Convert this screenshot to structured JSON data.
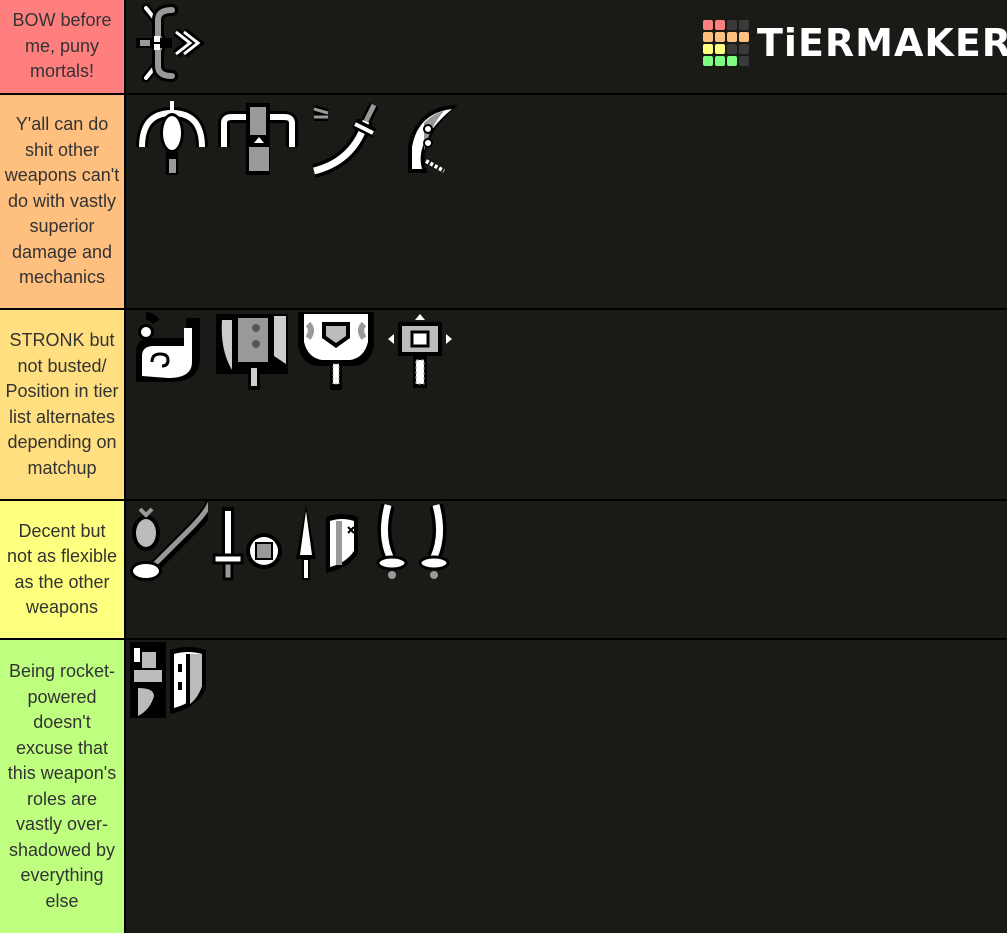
{
  "brand": {
    "name": "TiERMAKER",
    "grid_colors": [
      "#ff7f7f",
      "#ff7f7f",
      "#3a3a3a",
      "#3a3a3a",
      "#ffbf7f",
      "#ffbf7f",
      "#ffbf7f",
      "#ffbf7f",
      "#ffff7f",
      "#ffff7f",
      "#3a3a3a",
      "#3a3a3a",
      "#7fff7f",
      "#7fff7f",
      "#7fff7f",
      "#3a3a3a"
    ]
  },
  "tiers": [
    {
      "label": "BOW before me, puny mortals!",
      "color": "#ff7f7f",
      "items": [
        {
          "icon": "bow-icon"
        }
      ]
    },
    {
      "label": "Y'all can do shit other weapons can't do with vastly superior damage and mechanics",
      "color": "#ffbf7f",
      "items": [
        {
          "icon": "light-bowgun-icon"
        },
        {
          "icon": "heavy-bowgun-icon"
        },
        {
          "icon": "long-sword-icon"
        },
        {
          "icon": "charge-blade-icon"
        }
      ]
    },
    {
      "label": "STRONK but not busted/ Position in tier list alternates depending on matchup",
      "color": "#ffdf7f",
      "items": [
        {
          "icon": "hunting-horn-icon"
        },
        {
          "icon": "switch-axe-icon"
        },
        {
          "icon": "great-sword-icon"
        },
        {
          "icon": "hammer-icon"
        }
      ]
    },
    {
      "label": "Decent but not as flexible as the other weapons",
      "color": "#ffff7f",
      "items": [
        {
          "icon": "insect-glaive-icon"
        },
        {
          "icon": "sword-and-shield-icon"
        },
        {
          "icon": "lance-icon"
        },
        {
          "icon": "dual-blades-icon"
        }
      ]
    },
    {
      "label": "Being rocket-powered doesn't excuse that this weapon's roles are vastly over-shadowed by everything else",
      "color": "#bfff7f",
      "items": [
        {
          "icon": "gunlance-icon"
        }
      ]
    }
  ]
}
